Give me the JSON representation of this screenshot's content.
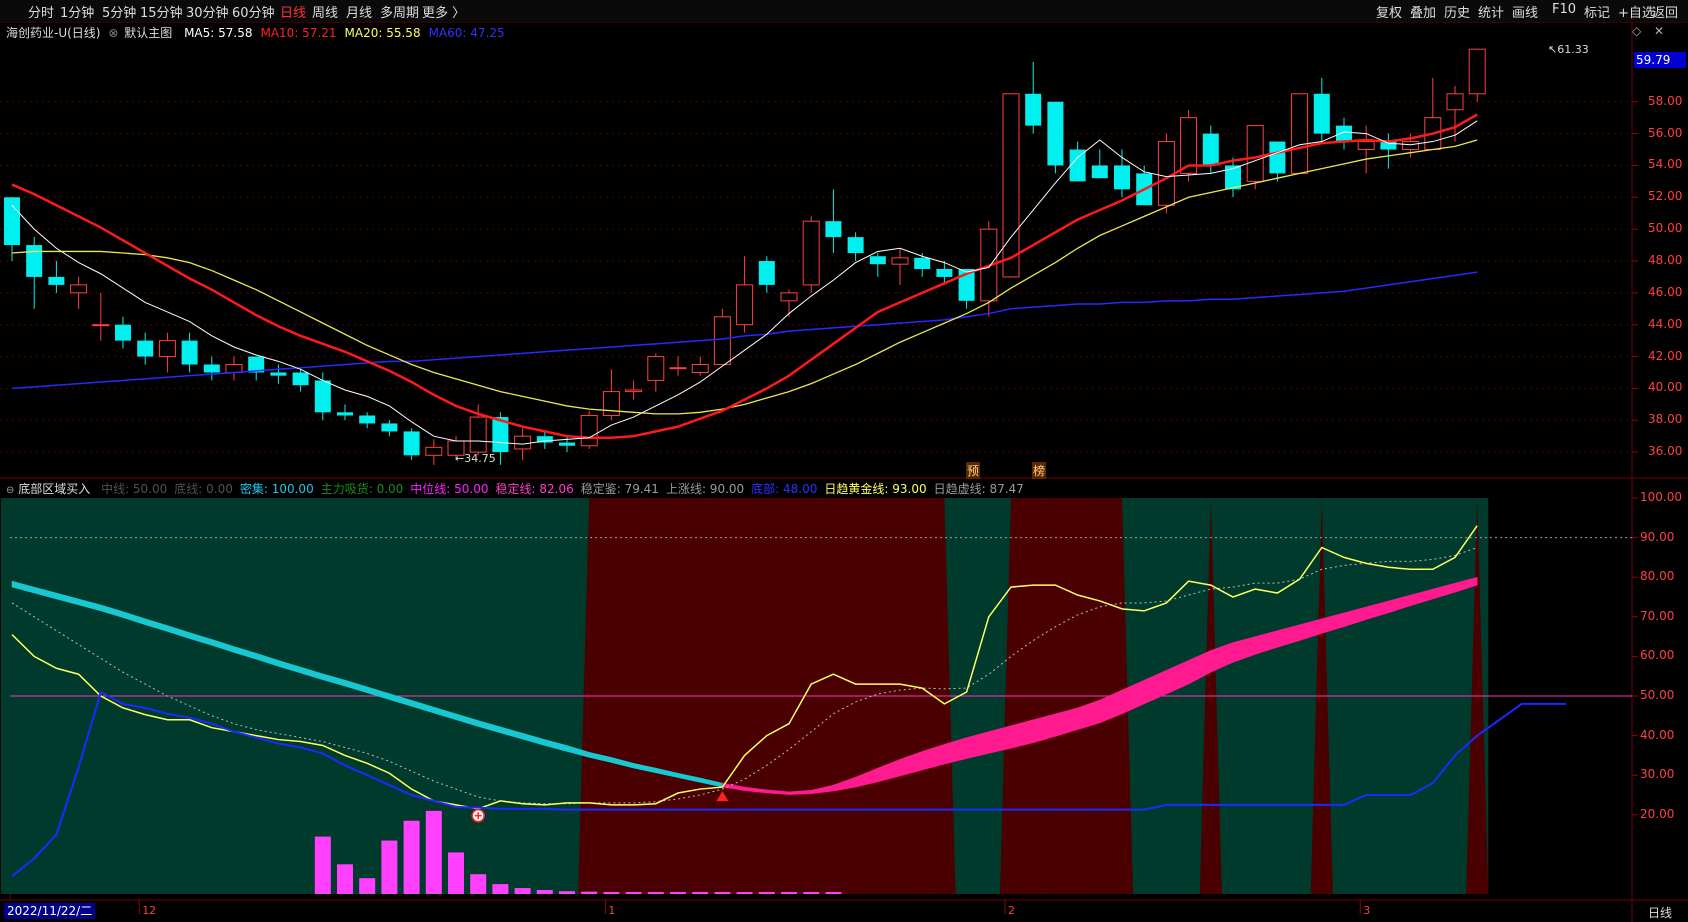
{
  "toolbar": {
    "period_tabs": [
      "分时",
      "1分钟",
      "5分钟",
      "15分钟",
      "30分钟",
      "60分钟",
      "日线",
      "周线",
      "月线",
      "多周期",
      "更多 〉"
    ],
    "active_tab": "日线",
    "right_tools": [
      "复权",
      "叠加",
      "历史",
      "统计",
      "画线",
      "F10",
      "标记",
      "+自选",
      "返回"
    ]
  },
  "main_chart": {
    "stock_name": "海创药业-U",
    "period": "(日线)",
    "template": "默认主图",
    "ma": [
      {
        "label": "MA5: 57.58",
        "color": "#ffffff"
      },
      {
        "label": "MA10: 57.21",
        "color": "#ff2020"
      },
      {
        "label": "MA20: 55.58",
        "color": "#ffff60"
      },
      {
        "label": "MA60: 47.25",
        "color": "#3030ff"
      }
    ],
    "price_axis": [
      "58.00",
      "56.00",
      "54.00",
      "52.00",
      "50.00",
      "48.00",
      "46.00",
      "44.00",
      "42.00",
      "40.00",
      "38.00",
      "36.00"
    ],
    "current_price": "59.79",
    "high_annotation": "61.33",
    "low_annotation": "34.75",
    "tag_yu": "预",
    "tag_bang": "榜"
  },
  "indicator": {
    "name": "底部区域买入",
    "values": [
      {
        "label": "中线: 50.00",
        "color": "#505050"
      },
      {
        "label": "底线: 0.00",
        "color": "#505050"
      },
      {
        "label": "密集: 100.00",
        "color": "#18c8e8"
      },
      {
        "label": "主力吸货: 0.00",
        "color": "#1a8a1a"
      },
      {
        "label": "中位线: 50.00",
        "color": "#ff20ff"
      },
      {
        "label": "稳定线: 82.06",
        "color": "#ff3cc8"
      },
      {
        "label": "稳定鉴: 79.41",
        "color": "#9a9a9a"
      },
      {
        "label": "上涨线: 90.00",
        "color": "#9a9a9a"
      },
      {
        "label": "底部: 48.00",
        "color": "#3030ff"
      },
      {
        "label": "日趋黄金线: 93.00",
        "color": "#ffff60"
      },
      {
        "label": "日趋虚线: 87.47",
        "color": "#9a9a9a"
      }
    ],
    "axis": [
      "100.00",
      "90.00",
      "80.00",
      "70.00",
      "60.00",
      "50.00",
      "40.00",
      "30.00",
      "20.00"
    ]
  },
  "x_axis": {
    "date_box": "2022/11/22/二",
    "months": [
      "12",
      "1",
      "2",
      "3"
    ],
    "period_label": "日线"
  },
  "chart_data": {
    "type": "candlestick",
    "ylim": [
      34.5,
      61.5
    ],
    "candles": [
      [
        52,
        49,
        52,
        48
      ],
      [
        49,
        47,
        49.5,
        45
      ],
      [
        47,
        46.5,
        48,
        46
      ],
      [
        46,
        46.5,
        47,
        45
      ],
      [
        44,
        44,
        46,
        43
      ],
      [
        44,
        43,
        44.5,
        42.5
      ],
      [
        43,
        42,
        43.5,
        41.5
      ],
      [
        42,
        43,
        43.5,
        41
      ],
      [
        43,
        41.5,
        43.5,
        41
      ],
      [
        41.5,
        41,
        42,
        40.5
      ],
      [
        41,
        41.5,
        42,
        40.5
      ],
      [
        42,
        41,
        42,
        40.5
      ],
      [
        41,
        40.8,
        41.5,
        40.3
      ],
      [
        41,
        40.2,
        41.3,
        39.8
      ],
      [
        40.5,
        38.5,
        41,
        38
      ],
      [
        38.5,
        38.3,
        39,
        38
      ],
      [
        38.3,
        37.8,
        38.5,
        37.5
      ],
      [
        37.8,
        37.3,
        38,
        37
      ],
      [
        37.3,
        35.8,
        37.5,
        35.5
      ],
      [
        35.8,
        36.3,
        36.8,
        35.2
      ],
      [
        35.8,
        36.7,
        37,
        35.5
      ],
      [
        36,
        38.2,
        39,
        35.8
      ],
      [
        38.2,
        36,
        38.5,
        35.2
      ],
      [
        36.2,
        37,
        37.5,
        35.5
      ],
      [
        37,
        36.6,
        37.3,
        36.2
      ],
      [
        36.6,
        36.4,
        37,
        36
      ],
      [
        36.4,
        38.3,
        38.6,
        36.2
      ],
      [
        38.3,
        39.8,
        41.2,
        38
      ],
      [
        39.8,
        39.9,
        40.5,
        39.3
      ],
      [
        40.5,
        42,
        42.2,
        39.8
      ],
      [
        41.3,
        41.3,
        42,
        40.8
      ],
      [
        41,
        41.5,
        42,
        40.8
      ],
      [
        41.5,
        44.5,
        45,
        41.5
      ],
      [
        44,
        46.5,
        48.3,
        43.5
      ],
      [
        48,
        46.5,
        48.3,
        46
      ],
      [
        45.5,
        46,
        46.2,
        44.5
      ],
      [
        46.5,
        50.5,
        50.8,
        46
      ],
      [
        50.5,
        49.5,
        52.5,
        48.5
      ],
      [
        49.5,
        48.5,
        49.8,
        48
      ],
      [
        48.3,
        47.8,
        48.5,
        47
      ],
      [
        47.8,
        48.2,
        48.8,
        46.5
      ],
      [
        48.2,
        47.5,
        48.5,
        47
      ],
      [
        47.5,
        47,
        48,
        46.5
      ],
      [
        47.5,
        45.5,
        47.5,
        45
      ],
      [
        45.5,
        50,
        50.5,
        44.5
      ],
      [
        47,
        58.5,
        58.5,
        47
      ],
      [
        58.5,
        56.5,
        60.5,
        56
      ],
      [
        58,
        54,
        58,
        53.5
      ],
      [
        55,
        53,
        55.5,
        53
      ],
      [
        54,
        53.2,
        55,
        53.2
      ],
      [
        54,
        52.5,
        55,
        52
      ],
      [
        53.5,
        51.5,
        54,
        51.5
      ],
      [
        51.5,
        55.5,
        56,
        51
      ],
      [
        53.5,
        57,
        57.5,
        53
      ],
      [
        56,
        54,
        56.5,
        53.5
      ],
      [
        54,
        52.5,
        54.5,
        52
      ],
      [
        53,
        56.5,
        56.5,
        52.5
      ],
      [
        55.5,
        53.5,
        55.5,
        53
      ],
      [
        53.5,
        58.5,
        58.5,
        53.5
      ],
      [
        58.5,
        56,
        59.5,
        55.5
      ],
      [
        56.5,
        55.5,
        57,
        55
      ],
      [
        55,
        55.5,
        56.5,
        53.5
      ],
      [
        55.5,
        55,
        56,
        53.8
      ],
      [
        55,
        55.5,
        56,
        54.5
      ],
      [
        55,
        57,
        59.5,
        55
      ],
      [
        57.5,
        58.5,
        59,
        55.5
      ],
      [
        58.5,
        61.3,
        61.3,
        58
      ]
    ],
    "ma5": [
      51.5,
      50,
      48.8,
      47.9,
      47.2,
      46.3,
      45.4,
      44.8,
      44.2,
      43.3,
      42.6,
      42.1,
      41.7,
      41.2,
      40.5,
      39.9,
      39.5,
      38.9,
      37.9,
      37,
      36.7,
      36.7,
      36.6,
      36.5,
      36.7,
      36.8,
      36.9,
      37.7,
      38.2,
      38.9,
      39.6,
      40.4,
      41.4,
      42.4,
      43.4,
      44.7,
      45.8,
      46.8,
      47.9,
      48.6,
      48.8,
      48.3,
      47.9,
      47.3,
      47.6,
      49.5,
      51.2,
      52.9,
      54.5,
      55.6,
      54.5,
      53.6,
      53.3,
      53.4,
      53.5,
      53.8,
      54.3,
      54.8,
      55.3,
      55.5,
      56.1,
      56,
      55.4,
      55.3,
      55.5,
      55.9,
      56.8
    ],
    "ma10": [
      52.8,
      52.2,
      51.5,
      50.8,
      50.1,
      49.3,
      48.5,
      47.7,
      46.9,
      46.2,
      45.4,
      44.6,
      43.9,
      43.3,
      42.8,
      42.3,
      41.7,
      41.1,
      40.4,
      39.6,
      38.9,
      38.4,
      38,
      37.6,
      37.3,
      37,
      36.9,
      36.9,
      37,
      37.3,
      37.6,
      38.1,
      38.6,
      39.3,
      40,
      40.8,
      41.8,
      42.8,
      43.8,
      44.8,
      45.4,
      46,
      46.6,
      47.2,
      47.7,
      48.2,
      49,
      49.8,
      50.6,
      51.2,
      51.8,
      52.5,
      53.2,
      54,
      54,
      54.3,
      54.5,
      54.8,
      55.1,
      55.4,
      55.5,
      55.6,
      55.5,
      55.7,
      56,
      56.4,
      57.2
    ],
    "ma20": [
      48.5,
      48.6,
      48.6,
      48.6,
      48.6,
      48.5,
      48.4,
      48.2,
      47.9,
      47.4,
      46.8,
      46.2,
      45.5,
      44.8,
      44.1,
      43.4,
      42.7,
      42.1,
      41.5,
      41,
      40.6,
      40.2,
      39.8,
      39.5,
      39.2,
      38.9,
      38.7,
      38.6,
      38.5,
      38.4,
      38.4,
      38.5,
      38.7,
      39,
      39.4,
      39.8,
      40.3,
      40.9,
      41.5,
      42.2,
      42.9,
      43.5,
      44.1,
      44.7,
      45.4,
      46.3,
      47.1,
      47.9,
      48.8,
      49.6,
      50.2,
      50.8,
      51.4,
      52,
      52.3,
      52.6,
      52.9,
      53.2,
      53.5,
      53.8,
      54.1,
      54.4,
      54.6,
      54.8,
      55,
      55.2,
      55.6
    ],
    "ma60": [
      40,
      40.1,
      40.2,
      40.3,
      40.4,
      40.5,
      40.6,
      40.7,
      40.8,
      40.9,
      41,
      41.1,
      41.2,
      41.3,
      41.4,
      41.5,
      41.6,
      41.7,
      41.7,
      41.8,
      41.9,
      42,
      42.1,
      42.2,
      42.3,
      42.4,
      42.5,
      42.6,
      42.7,
      42.8,
      42.9,
      43,
      43.1,
      43.3,
      43.4,
      43.6,
      43.7,
      43.8,
      43.9,
      44,
      44.1,
      44.2,
      44.3,
      44.5,
      44.7,
      45,
      45.1,
      45.2,
      45.3,
      45.3,
      45.4,
      45.4,
      45.5,
      45.5,
      45.6,
      45.6,
      45.7,
      45.8,
      45.9,
      46,
      46.1,
      46.3,
      46.5,
      46.7,
      46.9,
      47.1,
      47.3
    ],
    "indicator_ylim": [
      0,
      100
    ],
    "zones": [
      "g",
      "g",
      "g",
      "g",
      "g",
      "g",
      "g",
      "g",
      "g",
      "g",
      "g",
      "g",
      "g",
      "g",
      "g",
      "g",
      "g",
      "g",
      "g",
      "g",
      "g",
      "g",
      "g",
      "g",
      "g",
      "g",
      "r",
      "r",
      "r",
      "r",
      "r",
      "r",
      "r",
      "r",
      "r",
      "r",
      "r",
      "r",
      "r",
      "r",
      "r",
      "r",
      "r",
      "g",
      "g",
      "r",
      "r",
      "r",
      "r",
      "r",
      "r",
      "g",
      "g",
      "g",
      "r",
      "g",
      "g",
      "g",
      "g",
      "r",
      "g",
      "g",
      "g",
      "g",
      "g",
      "g",
      "r"
    ],
    "stable_line": [
      79,
      77.5,
      76,
      74.5,
      73,
      71.3,
      69.5,
      67.8,
      66,
      64.3,
      62.5,
      60.8,
      59,
      57.3,
      55.6,
      54,
      52.3,
      50.6,
      48.9,
      47.2,
      45.5,
      43.8,
      42.2,
      40.6,
      39,
      37.5,
      35.8,
      34.5,
      33,
      31.8,
      30.5,
      29.3,
      28,
      27,
      26.3,
      25.8,
      26.2,
      27.5,
      29.5,
      31.8,
      34,
      36,
      37.8,
      39.5,
      41,
      42.5,
      44,
      45.5,
      47,
      49,
      51.5,
      54,
      56.5,
      59,
      61.5,
      63.5,
      65,
      66.5,
      68,
      69.5,
      71,
      72.5,
      74,
      75.5,
      77,
      78.5,
      80
    ],
    "stable_line_lower": [
      77.5,
      76,
      74.5,
      73,
      71.5,
      69.8,
      68,
      66.3,
      64.5,
      62.8,
      61,
      59.3,
      57.5,
      55.8,
      54.1,
      52.5,
      50.8,
      49.1,
      47.4,
      45.7,
      44,
      42.3,
      40.7,
      39.1,
      37.5,
      36,
      34.5,
      33.2,
      31.8,
      30.6,
      29.4,
      28.2,
      27,
      26.1,
      25.5,
      25.1,
      25.3,
      26,
      27,
      28.3,
      29.8,
      31.3,
      32.8,
      34.2,
      35.5,
      36.8,
      38.2,
      39.8,
      41.5,
      43.2,
      45.5,
      48,
      50.5,
      53,
      56,
      58.5,
      60.5,
      62.3,
      64,
      65.8,
      67.5,
      69.3,
      71,
      72.8,
      74.5,
      76.2,
      78
    ],
    "gold_line": [
      65.5,
      60,
      57,
      55.5,
      50,
      47,
      45.3,
      44,
      44,
      42,
      41,
      40,
      39,
      38.5,
      37.5,
      35,
      33,
      30.5,
      26.5,
      23.5,
      22.5,
      21.5,
      23.5,
      22.8,
      22.5,
      23,
      23,
      22.5,
      22.5,
      22.8,
      25.5,
      26.5,
      27,
      35,
      40,
      43,
      53,
      55.5,
      53,
      53,
      53,
      52,
      48,
      51,
      70,
      77.5,
      78,
      78,
      75.5,
      74,
      72,
      71.5,
      73.5,
      79,
      78,
      75,
      77,
      76,
      79.5,
      87.5,
      85,
      83.5,
      82.5,
      82,
      82,
      85,
      93
    ],
    "dashed_line": [
      73.5,
      70,
      66.5,
      63,
      59.5,
      56,
      53,
      50,
      47.5,
      45,
      43,
      41.5,
      40.5,
      39.5,
      38.5,
      37,
      35.5,
      33.5,
      31,
      28.5,
      26.5,
      24.5,
      23.5,
      23,
      22.8,
      22.8,
      23,
      23,
      23,
      23.3,
      24,
      25,
      26.5,
      29,
      32.5,
      36.5,
      41,
      45.5,
      48.5,
      50.5,
      51.5,
      52,
      51.8,
      52,
      55.5,
      60,
      64,
      67.5,
      70.5,
      72.5,
      73.5,
      73.5,
      74,
      75.5,
      77,
      77.5,
      78.5,
      78.5,
      79.5,
      82,
      83,
      83.5,
      84,
      84,
      84.5,
      85.5,
      87.5
    ],
    "bottom_line": [
      4.5,
      9,
      15,
      32,
      51,
      48,
      47,
      45.5,
      44.5,
      43,
      41,
      39.5,
      38,
      37,
      35.5,
      32.5,
      30,
      27.5,
      25,
      23.5,
      22,
      21.8,
      21.5,
      21.5,
      21.5,
      21.3,
      21.3,
      21.3,
      21.3,
      21.3,
      21.3,
      21.3,
      21.3,
      21.3,
      21.3,
      21.3,
      21.3,
      21.3,
      21.3,
      21.3,
      21.3,
      21.3,
      21.3,
      21.3,
      21.3,
      21.3,
      21.3,
      21.3,
      21.3,
      21.3,
      21.3,
      21.3,
      22.5,
      22.5,
      22.5,
      22.5,
      22.5,
      22.5,
      22.5,
      22.5,
      22.5,
      25,
      25,
      25,
      28,
      35,
      40,
      44,
      48,
      48,
      48
    ],
    "volume_bars": [
      0,
      0,
      0,
      0,
      0,
      0,
      0,
      0,
      0,
      0,
      0,
      0,
      0,
      0,
      14.5,
      7.5,
      4,
      13.5,
      18.5,
      21,
      10.5,
      5,
      2.5,
      1.5,
      1,
      0.7,
      0.6,
      0.5,
      0.5,
      0.5,
      0.5,
      0.5,
      0.5,
      0.5,
      0.5,
      0.5,
      0.5,
      0.5,
      0,
      0,
      0,
      0,
      0,
      0,
      0,
      0,
      0,
      0,
      0,
      0,
      0,
      0,
      0,
      0,
      0,
      0,
      0,
      0,
      0,
      0,
      0,
      0,
      0,
      0,
      0,
      0,
      0
    ],
    "buy_signal_index": 32,
    "plus_marker_index": 21,
    "midline": 50,
    "upper_line": 90
  }
}
